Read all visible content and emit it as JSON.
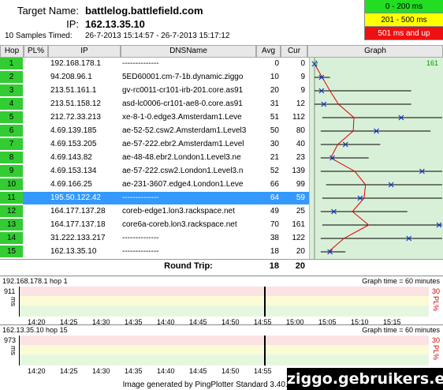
{
  "header": {
    "target_label": "Target Name:",
    "target_value": "battlelog.battlefield.com",
    "ip_label": "IP:",
    "ip_value": "162.13.35.10",
    "samples_label": "10 Samples Timed:",
    "samples_value": "26-7-2013 15:14:57 - 26-7-2013 15:17:12"
  },
  "legend": [
    {
      "label": "0 - 200 ms",
      "color": "#22dd22"
    },
    {
      "label": "201 - 500 ms",
      "color": "#ffff00"
    },
    {
      "label": "501 ms and up",
      "color": "#ee1111"
    }
  ],
  "columns": [
    "Hop",
    "PL%",
    "IP",
    "DNSName",
    "Avg",
    "Cur",
    "Graph"
  ],
  "graph_scale": {
    "min": "0",
    "max": "161"
  },
  "hops": [
    {
      "hop": "1",
      "pl": "",
      "ip": "192.168.178.1",
      "dns": "--------------",
      "avg": "0",
      "cur": "0"
    },
    {
      "hop": "2",
      "pl": "",
      "ip": "94.208.96.1",
      "dns": "5ED60001.cm-7-1b.dynamic.ziggo",
      "avg": "10",
      "cur": "9"
    },
    {
      "hop": "3",
      "pl": "",
      "ip": "213.51.161.1",
      "dns": "gv-rc0011-cr101-irb-201.core.as91",
      "avg": "20",
      "cur": "9"
    },
    {
      "hop": "4",
      "pl": "",
      "ip": "213.51.158.12",
      "dns": "asd-lc0006-cr101-ae8-0.core.as91",
      "avg": "31",
      "cur": "12"
    },
    {
      "hop": "5",
      "pl": "",
      "ip": "212.72.33.213",
      "dns": "xe-8-1-0.edge3.Amsterdam1.Leve",
      "avg": "51",
      "cur": "112"
    },
    {
      "hop": "6",
      "pl": "",
      "ip": "4.69.139.185",
      "dns": "ae-52-52.csw2.Amsterdam1.Level3",
      "avg": "50",
      "cur": "80"
    },
    {
      "hop": "7",
      "pl": "",
      "ip": "4.69.153.205",
      "dns": "ae-57-222.ebr2.Amsterdam1.Level",
      "avg": "30",
      "cur": "40"
    },
    {
      "hop": "8",
      "pl": "",
      "ip": "4.69.143.82",
      "dns": "ae-48-48.ebr2.London1.Level3.ne",
      "avg": "21",
      "cur": "23"
    },
    {
      "hop": "9",
      "pl": "",
      "ip": "4.69.153.134",
      "dns": "ae-57-222.csw2.London1.Level3.n",
      "avg": "52",
      "cur": "139"
    },
    {
      "hop": "10",
      "pl": "",
      "ip": "4.69.166.25",
      "dns": "ae-231-3607.edge4.London1.Leve",
      "avg": "66",
      "cur": "99"
    },
    {
      "hop": "11",
      "pl": "",
      "ip": "195.50.122.42",
      "dns": "--------------",
      "avg": "64",
      "cur": "59"
    },
    {
      "hop": "12",
      "pl": "",
      "ip": "164.177.137.28",
      "dns": "coreb-edge1.lon3.rackspace.net",
      "avg": "49",
      "cur": "25"
    },
    {
      "hop": "13",
      "pl": "",
      "ip": "164.177.137.18",
      "dns": "core6a-coreb.lon3.rackspace.net",
      "avg": "70",
      "cur": "161"
    },
    {
      "hop": "14",
      "pl": "",
      "ip": "31.222.133.217",
      "dns": "--------------",
      "avg": "38",
      "cur": "122"
    },
    {
      "hop": "15",
      "pl": "",
      "ip": "162.13.35.10",
      "dns": "--------------",
      "avg": "18",
      "cur": "20"
    }
  ],
  "graph_ranges": [
    [
      0,
      0
    ],
    [
      0,
      20
    ],
    [
      0,
      125
    ],
    [
      0,
      125
    ],
    [
      10,
      165
    ],
    [
      8,
      150
    ],
    [
      8,
      85
    ],
    [
      8,
      70
    ],
    [
      8,
      165
    ],
    [
      15,
      165
    ],
    [
      10,
      165
    ],
    [
      8,
      120
    ],
    [
      10,
      165
    ],
    [
      8,
      165
    ],
    [
      8,
      40
    ]
  ],
  "round_trip": {
    "label": "Round Trip:",
    "avg": "18",
    "cur": "20"
  },
  "time_graphs": [
    {
      "title": "192.168.178.1 hop 1",
      "graph_time": "Graph time = 60 minutes",
      "ymax": "911",
      "unit": "ms",
      "pl_top": "30",
      "pl_label": "PL%",
      "ticks": [
        "14:20",
        "14:25",
        "14:30",
        "14:35",
        "14:40",
        "14:45",
        "14:50",
        "14:55",
        "15:00",
        "15:05",
        "15:10",
        "15:15"
      ],
      "spike": "14:52"
    },
    {
      "title": "162.13.35.10 hop 15",
      "graph_time": "Graph time = 60 minutes",
      "ymax": "973",
      "unit": "ms",
      "pl_top": "30",
      "pl_label": "PL%",
      "ticks": [
        "14:20",
        "14:25",
        "14:30",
        "14:35",
        "14:40",
        "14:45",
        "14:50",
        "14:55",
        "15:00",
        "15:05",
        "15:10",
        "15:15"
      ],
      "spike": "14:52"
    }
  ],
  "footer": "Image generated by PingPlotter Standard 3.40.2s (http://",
  "watermark": "ziggo.gebruikers.eu"
}
